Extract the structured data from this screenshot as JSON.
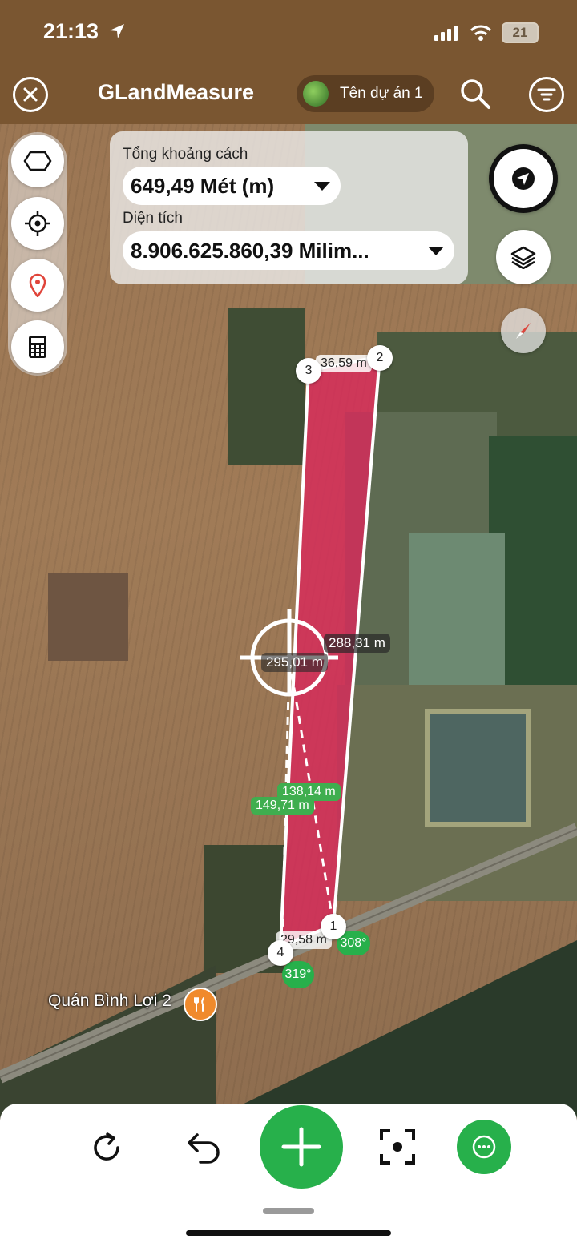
{
  "status_bar": {
    "time": "21:13",
    "battery": "21"
  },
  "header": {
    "title": "GLandMeasure",
    "project_name": "Tên dự án 1"
  },
  "info_panel": {
    "distance_label": "Tổng khoảng cách",
    "distance_value": "649,49 Mét (m)",
    "area_label": "Diện tích",
    "area_value": "8.906.625.860,39 Milim..."
  },
  "polygon": {
    "vertices": [
      "1",
      "2",
      "3",
      "4"
    ],
    "edge_labels": {
      "top": "36,59 m",
      "right": "288,31 m",
      "left_current": "295,01 m",
      "bottom": "29,58 m"
    },
    "guide_labels": {
      "guide_a": "138,14 m",
      "guide_b": "149,71 m"
    },
    "angle_labels": {
      "angle_1": "308°",
      "angle_4": "319°"
    },
    "fill_color": "#d8295a"
  },
  "place_label": "Quán Bình Lợi 2",
  "colors": {
    "header_bg": "#7a5631",
    "accent_green": "#27b04b",
    "label_green": "#3fae4f"
  },
  "icons": {
    "close": "close-icon",
    "search": "search-icon",
    "menu": "filter-menu-icon",
    "polygon": "polygon-icon",
    "crosshair": "crosshair-icon",
    "pin": "location-pin-icon",
    "calculator": "calculator-icon",
    "navigate": "navigation-arrow-icon",
    "layers": "layers-icon",
    "compass": "compass-icon",
    "refresh": "refresh-icon",
    "undo": "undo-icon",
    "add": "plus-icon",
    "focus": "focus-target-icon",
    "more": "more-icon"
  }
}
